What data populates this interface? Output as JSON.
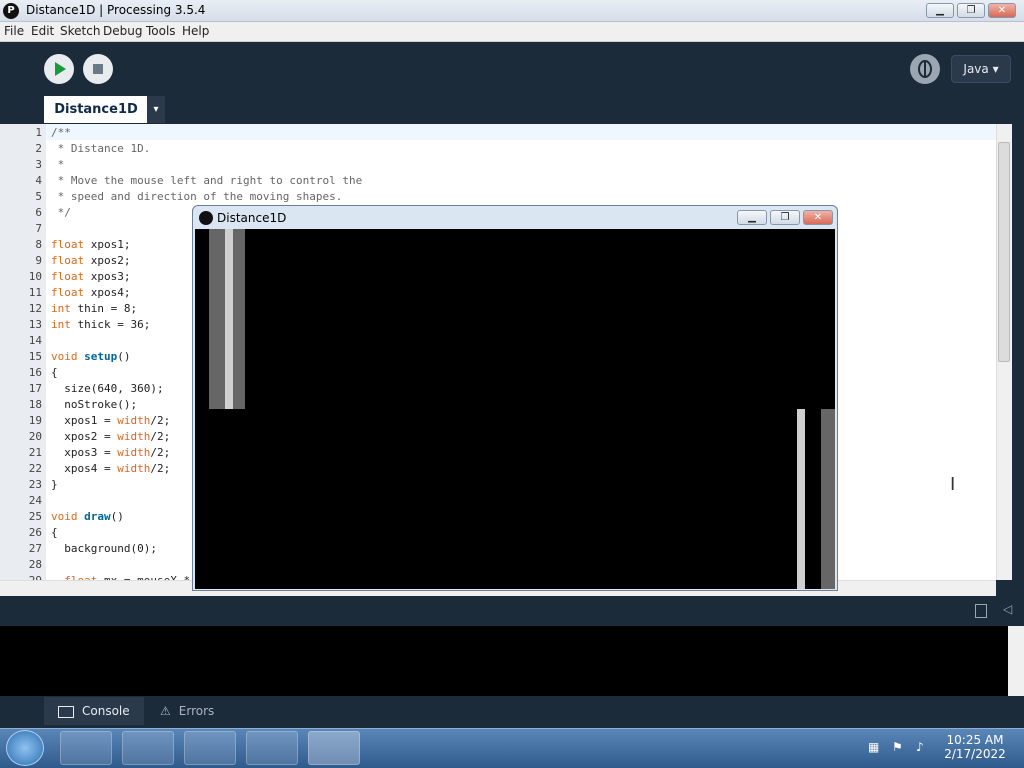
{
  "window": {
    "title": "Distance1D | Processing 3.5.4",
    "minimize_glyph": "▁",
    "maximize_glyph": "❐",
    "close_glyph": "✕"
  },
  "menu": [
    "File",
    "Edit",
    "Sketch",
    "Debug",
    "Tools",
    "Help"
  ],
  "toolbar": {
    "mode_label": "Java ▾"
  },
  "tab": {
    "label": "Distance1D",
    "menu_glyph": "▾"
  },
  "editor": {
    "lines": [
      {
        "n": "1",
        "code": "/**"
      },
      {
        "n": "2",
        "code": " * Distance 1D."
      },
      {
        "n": "3",
        "code": " *"
      },
      {
        "n": "4",
        "code": " * Move the mouse left and right to control the"
      },
      {
        "n": "5",
        "code": " * speed and direction of the moving shapes."
      },
      {
        "n": "6",
        "code": " */"
      },
      {
        "n": "7",
        "code": ""
      },
      {
        "n": "8",
        "code": "float xpos1;"
      },
      {
        "n": "9",
        "code": "float xpos2;"
      },
      {
        "n": "10",
        "code": "float xpos3;"
      },
      {
        "n": "11",
        "code": "float xpos4;"
      },
      {
        "n": "12",
        "code": "int thin = 8;"
      },
      {
        "n": "13",
        "code": "int thick = 36;"
      },
      {
        "n": "14",
        "code": ""
      },
      {
        "n": "15",
        "code": "void setup()"
      },
      {
        "n": "16",
        "code": "{"
      },
      {
        "n": "17",
        "code": "  size(640, 360);"
      },
      {
        "n": "18",
        "code": "  noStroke();"
      },
      {
        "n": "19",
        "code": "  xpos1 = width/2;"
      },
      {
        "n": "20",
        "code": "  xpos2 = width/2;"
      },
      {
        "n": "21",
        "code": "  xpos3 = width/2;"
      },
      {
        "n": "22",
        "code": "  xpos4 = width/2;"
      },
      {
        "n": "23",
        "code": "}"
      },
      {
        "n": "24",
        "code": ""
      },
      {
        "n": "25",
        "code": "void draw()"
      },
      {
        "n": "26",
        "code": "{"
      },
      {
        "n": "27",
        "code": "  background(0);"
      },
      {
        "n": "28",
        "code": ""
      },
      {
        "n": "29",
        "code": "  float mx = mouseX *"
      }
    ]
  },
  "sketch_window": {
    "title": "Distance1D"
  },
  "footer": {
    "console_label": "Console",
    "errors_label": "Errors"
  },
  "taskbar": {
    "time": "10:25 AM",
    "date": "2/17/2022"
  },
  "colors": {
    "ide_bg": "#1c2b3a",
    "keyword": "#E2661A",
    "function": "#006699"
  }
}
